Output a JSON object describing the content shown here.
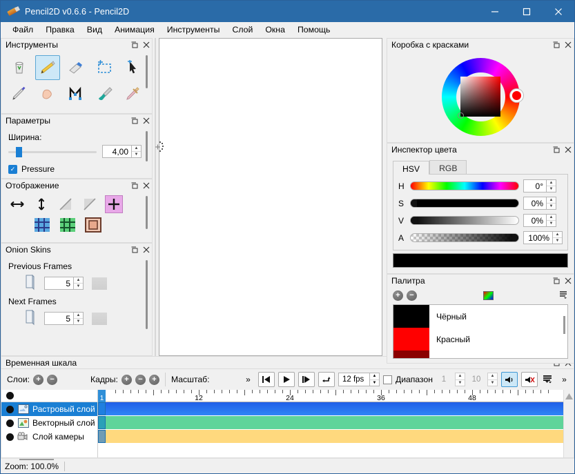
{
  "window": {
    "title": "Pencil2D v0.6.6 - Pencil2D",
    "minimize": "—",
    "maximize": "□",
    "close": "✕"
  },
  "menubar": {
    "items": [
      {
        "label": "Файл"
      },
      {
        "label": "Правка"
      },
      {
        "label": "Вид"
      },
      {
        "label": "Анимация"
      },
      {
        "label": "Инструменты"
      },
      {
        "label": "Слой"
      },
      {
        "label": "Окна"
      },
      {
        "label": "Помощь"
      }
    ]
  },
  "panels": {
    "tools": {
      "title": "Инструменты",
      "float_icon": "float-icon",
      "close_icon": "close-icon",
      "items": [
        {
          "name": "clear-tool",
          "icon": "trash-icon",
          "active": false
        },
        {
          "name": "pencil-tool",
          "icon": "pencil-icon",
          "active": true
        },
        {
          "name": "eraser-tool",
          "icon": "eraser-icon",
          "active": false
        },
        {
          "name": "select-tool",
          "icon": "marquee-icon",
          "active": false
        },
        {
          "name": "move-tool",
          "icon": "arrow-cursor-icon",
          "active": false
        },
        {
          "name": "pen-tool",
          "icon": "fountain-pen-icon",
          "active": false
        },
        {
          "name": "hand-tool",
          "icon": "hand-icon",
          "active": false
        },
        {
          "name": "polyline-tool",
          "icon": "polyline-icon",
          "active": false
        },
        {
          "name": "brush-tool",
          "icon": "brush-icon",
          "active": false
        },
        {
          "name": "eyedropper-tool",
          "icon": "eyedropper-icon",
          "active": false
        }
      ]
    },
    "parameters": {
      "title": "Параметры",
      "width_label": "Ширина:",
      "width_value": "4,00",
      "pressure_label": "Pressure",
      "pressure_checked": true,
      "check_glyph": "✓"
    },
    "display": {
      "title": "Отображение",
      "buttons": [
        {
          "name": "flip-horizontal-button",
          "icon": "arrows-horizontal-icon",
          "selected": false,
          "disabled": false
        },
        {
          "name": "flip-vertical-button",
          "icon": "arrows-vertical-icon",
          "selected": false,
          "disabled": false
        },
        {
          "name": "rotate-clockwise-button",
          "icon": "diagonal-up-icon",
          "selected": false,
          "disabled": true
        },
        {
          "name": "rotate-counterclockwise-button",
          "icon": "diagonal-down-icon",
          "selected": false,
          "disabled": true
        },
        {
          "name": "center-crosshair-button",
          "icon": "plus-cross-icon",
          "selected": true,
          "disabled": false
        },
        {
          "name": "grid-blue-button",
          "icon": "grid-blue-icon",
          "selected": false,
          "disabled": false
        },
        {
          "name": "grid-green-button",
          "icon": "grid-green-icon",
          "selected": false,
          "disabled": false
        },
        {
          "name": "overlay-frame-button",
          "icon": "frame-overlay-icon",
          "selected": false,
          "disabled": false
        }
      ]
    },
    "onion": {
      "title": "Onion Skins",
      "previous_label": "Previous Frames",
      "previous_value": "5",
      "next_label": "Next Frames",
      "next_value": "5"
    },
    "colorbox": {
      "title": "Коробка с красками"
    },
    "inspector": {
      "title": "Инспектор цвета",
      "tabs": [
        {
          "label": "HSV",
          "active": true
        },
        {
          "label": "RGB",
          "active": false
        }
      ],
      "rows": [
        {
          "name": "H",
          "value": "0°"
        },
        {
          "name": "S",
          "value": "0%"
        },
        {
          "name": "V",
          "value": "0%"
        },
        {
          "name": "A",
          "value": "100%"
        }
      ],
      "current_color": "#000000"
    },
    "palette": {
      "title": "Палитра",
      "add_glyph": "+",
      "remove_glyph": "−",
      "colors": [
        {
          "name": "Чёрный",
          "hex": "#000000"
        },
        {
          "name": "Красный",
          "hex": "#ff0000"
        },
        {
          "name": "",
          "hex": "#8b0000"
        }
      ]
    }
  },
  "timeline": {
    "title": "Временная шкала",
    "layers_label": "Слои:",
    "frames_label": "Кадры:",
    "scale_label": "Масштаб:",
    "overflow_glyph": "»",
    "fps_value": "12 fps",
    "range_label": "Диапазон",
    "range_start": "1",
    "range_end": "10",
    "ruler_marks": [
      {
        "label": "1",
        "frame": 1
      },
      {
        "label": "12",
        "frame": 12
      },
      {
        "label": "24",
        "frame": 24
      },
      {
        "label": "36",
        "frame": 36
      },
      {
        "label": "48",
        "frame": 48
      }
    ],
    "current_frame": "1",
    "layers": [
      {
        "label": "Растровый слой",
        "icon": "bitmap-layer-icon",
        "selected": true,
        "track_color": "#1a6ff0",
        "key_color": "#2f8fd8"
      },
      {
        "label": "Векторный слой",
        "icon": "vector-layer-icon",
        "selected": false,
        "track_color": "#5fd49a",
        "key_color": "#2aa0b8"
      },
      {
        "label": "Слой камеры",
        "icon": "camera-layer-icon",
        "selected": false,
        "track_color": "#ffd97e",
        "key_color": "#6f9cb5"
      }
    ]
  },
  "statusbar": {
    "zoom_text": "Zoom: 100.0%"
  }
}
